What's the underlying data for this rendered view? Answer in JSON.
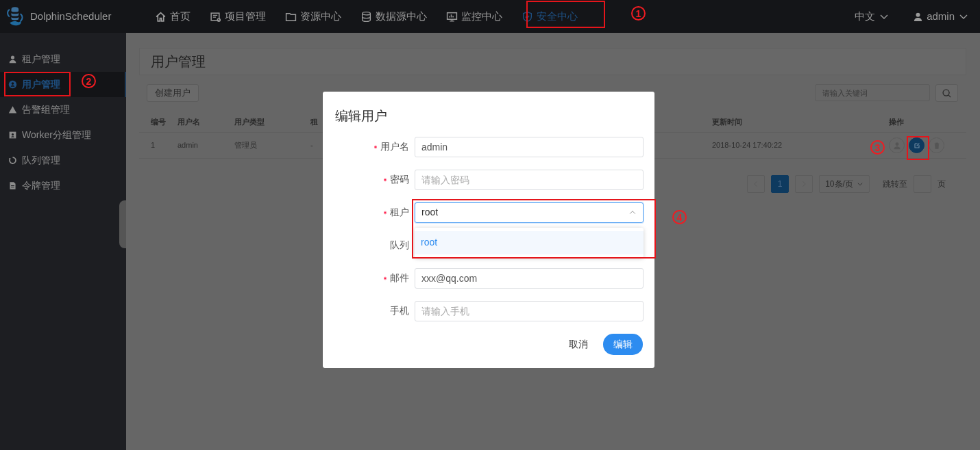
{
  "brand": {
    "name": "DolphinScheduler"
  },
  "nav": [
    {
      "label": "首页",
      "selected": false
    },
    {
      "label": "项目管理",
      "selected": false
    },
    {
      "label": "资源中心",
      "selected": false
    },
    {
      "label": "数据源中心",
      "selected": false
    },
    {
      "label": "监控中心",
      "selected": false
    },
    {
      "label": "安全中心",
      "selected": true
    }
  ],
  "language": {
    "label": "中文"
  },
  "user": {
    "label": "admin"
  },
  "sidebar": [
    {
      "label": "租户管理",
      "selected": false
    },
    {
      "label": "用户管理",
      "selected": true
    },
    {
      "label": "告警组管理",
      "selected": false
    },
    {
      "label": "Worker分组管理",
      "selected": false
    },
    {
      "label": "队列管理",
      "selected": false
    },
    {
      "label": "令牌管理",
      "selected": false
    }
  ],
  "page_title": "用户管理",
  "create_button": "创建用户",
  "search": {
    "placeholder": "请输入关键词"
  },
  "table": {
    "columns": [
      "编号",
      "用户名",
      "用户类型",
      "租",
      "更新时间",
      "操作"
    ],
    "rows": [
      {
        "cells": [
          "1",
          "admin",
          "管理员",
          "-",
          "2018-10-24 17:40:22"
        ],
        "actions": [
          {
            "selected": false
          },
          {
            "selected": true
          },
          {
            "selected": false
          }
        ]
      }
    ]
  },
  "pagination": {
    "pages": [
      {
        "label": "1",
        "selected": true
      }
    ],
    "page_size": "10条/页",
    "jump_label": "跳转至",
    "page_unit": "页"
  },
  "dialog": {
    "title": "编辑用户",
    "fields": [
      {
        "label": "用户名",
        "required": true,
        "kind": "text",
        "value": "admin"
      },
      {
        "label": "密码",
        "required": true,
        "kind": "text",
        "placeholder": "请输入密码"
      },
      {
        "label": "租户",
        "required": true,
        "kind": "select",
        "value": "root",
        "expanded": true,
        "options": [
          {
            "label": "root",
            "selected": true
          }
        ]
      },
      {
        "label": "队列",
        "required": false,
        "kind": "covered"
      },
      {
        "label": "邮件",
        "required": true,
        "kind": "text",
        "value": "xxx@qq.com"
      },
      {
        "label": "手机",
        "required": false,
        "kind": "text",
        "placeholder": "请输入手机"
      }
    ],
    "buttons": [
      {
        "label": "取消",
        "kind": "plain"
      },
      {
        "label": "编辑",
        "kind": "primary"
      }
    ]
  },
  "annotations": [
    {
      "number": "1"
    },
    {
      "number": "2"
    },
    {
      "number": "3"
    },
    {
      "number": "4"
    }
  ]
}
